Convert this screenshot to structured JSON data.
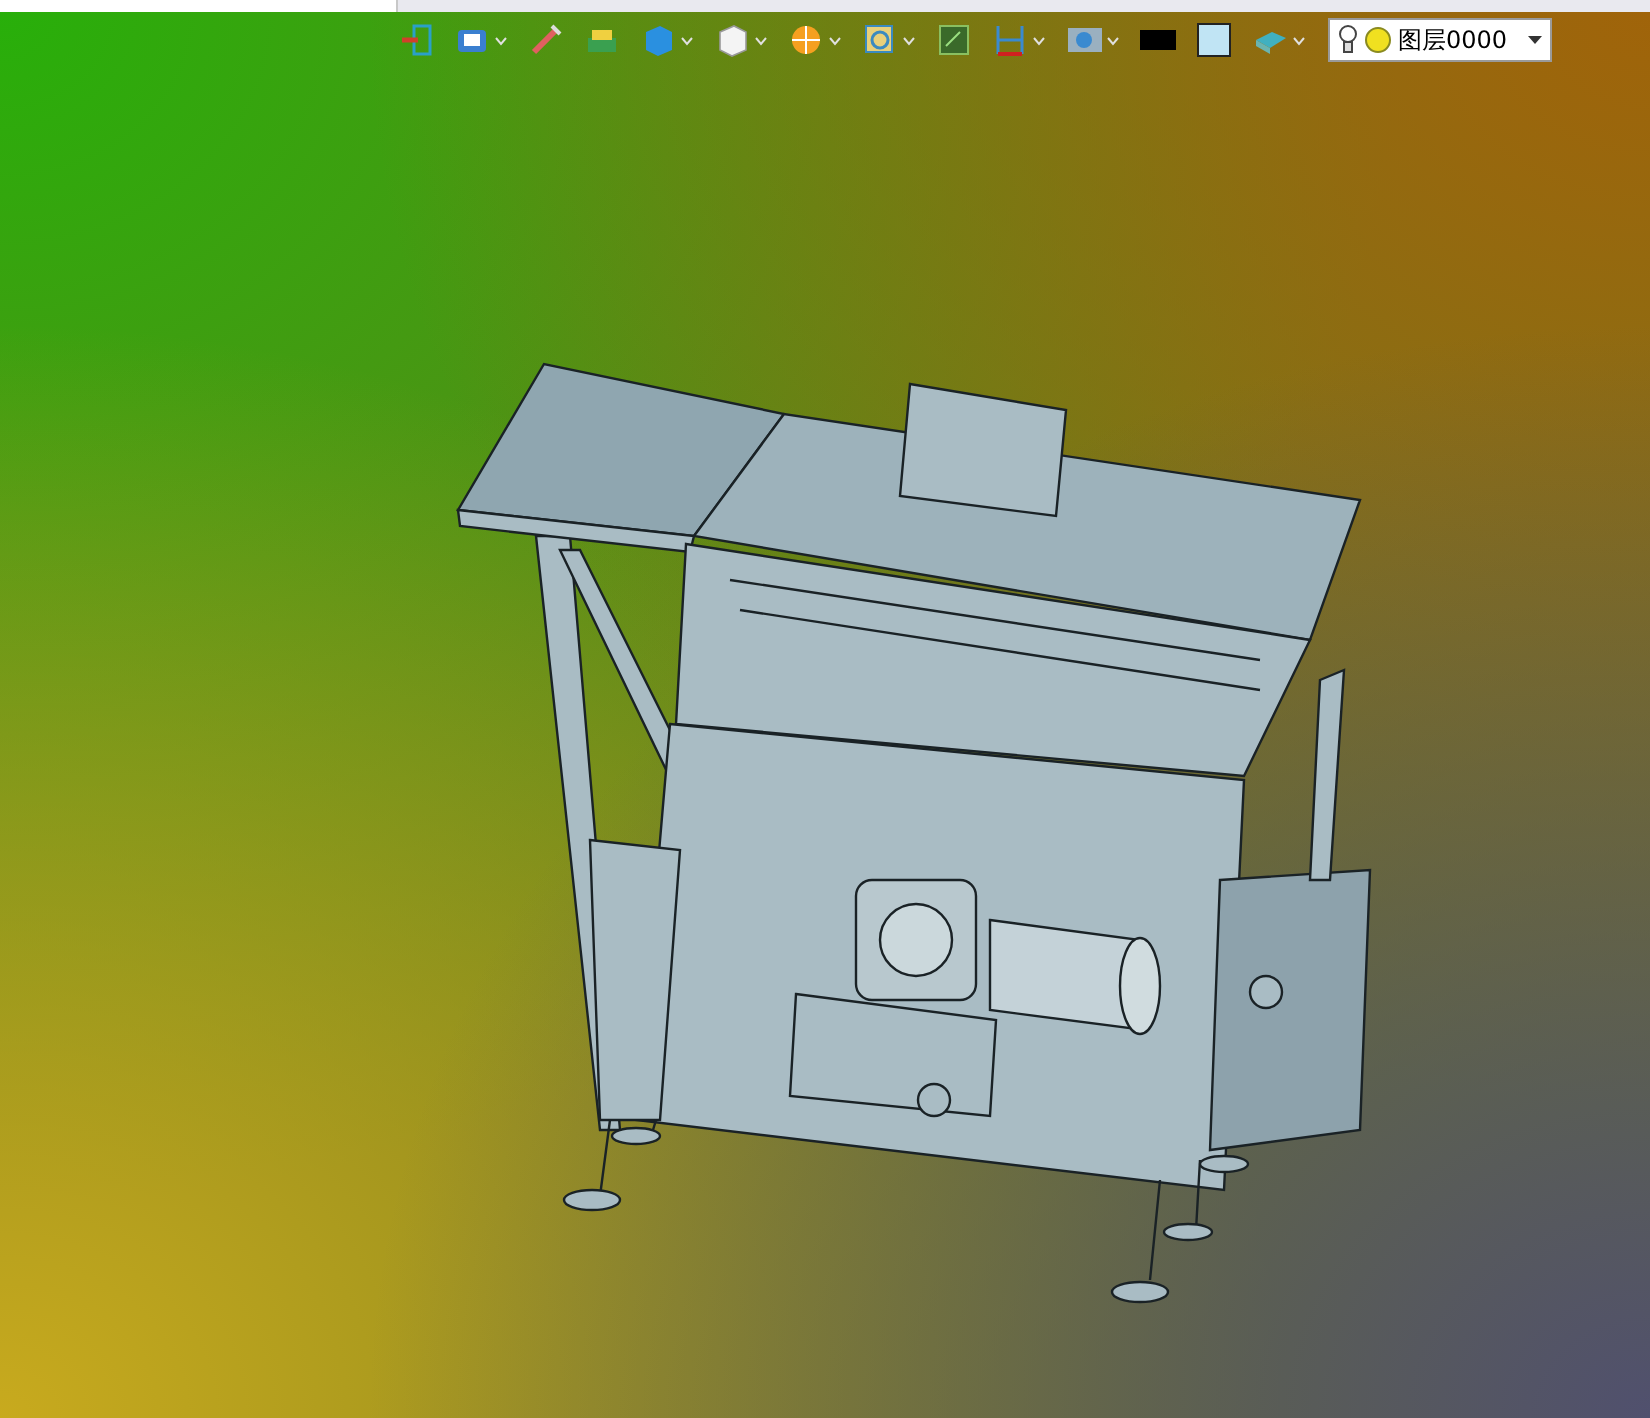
{
  "toolbar": {
    "items": [
      {
        "kind": "button"
      },
      {
        "kind": "dropdown"
      },
      {
        "kind": "button"
      },
      {
        "kind": "button"
      },
      {
        "kind": "dropdown"
      },
      {
        "kind": "dropdown"
      },
      {
        "kind": "dropdown"
      },
      {
        "kind": "dropdown"
      },
      {
        "kind": "button"
      },
      {
        "kind": "dropdown"
      },
      {
        "kind": "dropdown"
      },
      {
        "kind": "button"
      },
      {
        "kind": "button"
      },
      {
        "kind": "dropdown"
      }
    ],
    "layer": {
      "value": "图层0000"
    }
  }
}
